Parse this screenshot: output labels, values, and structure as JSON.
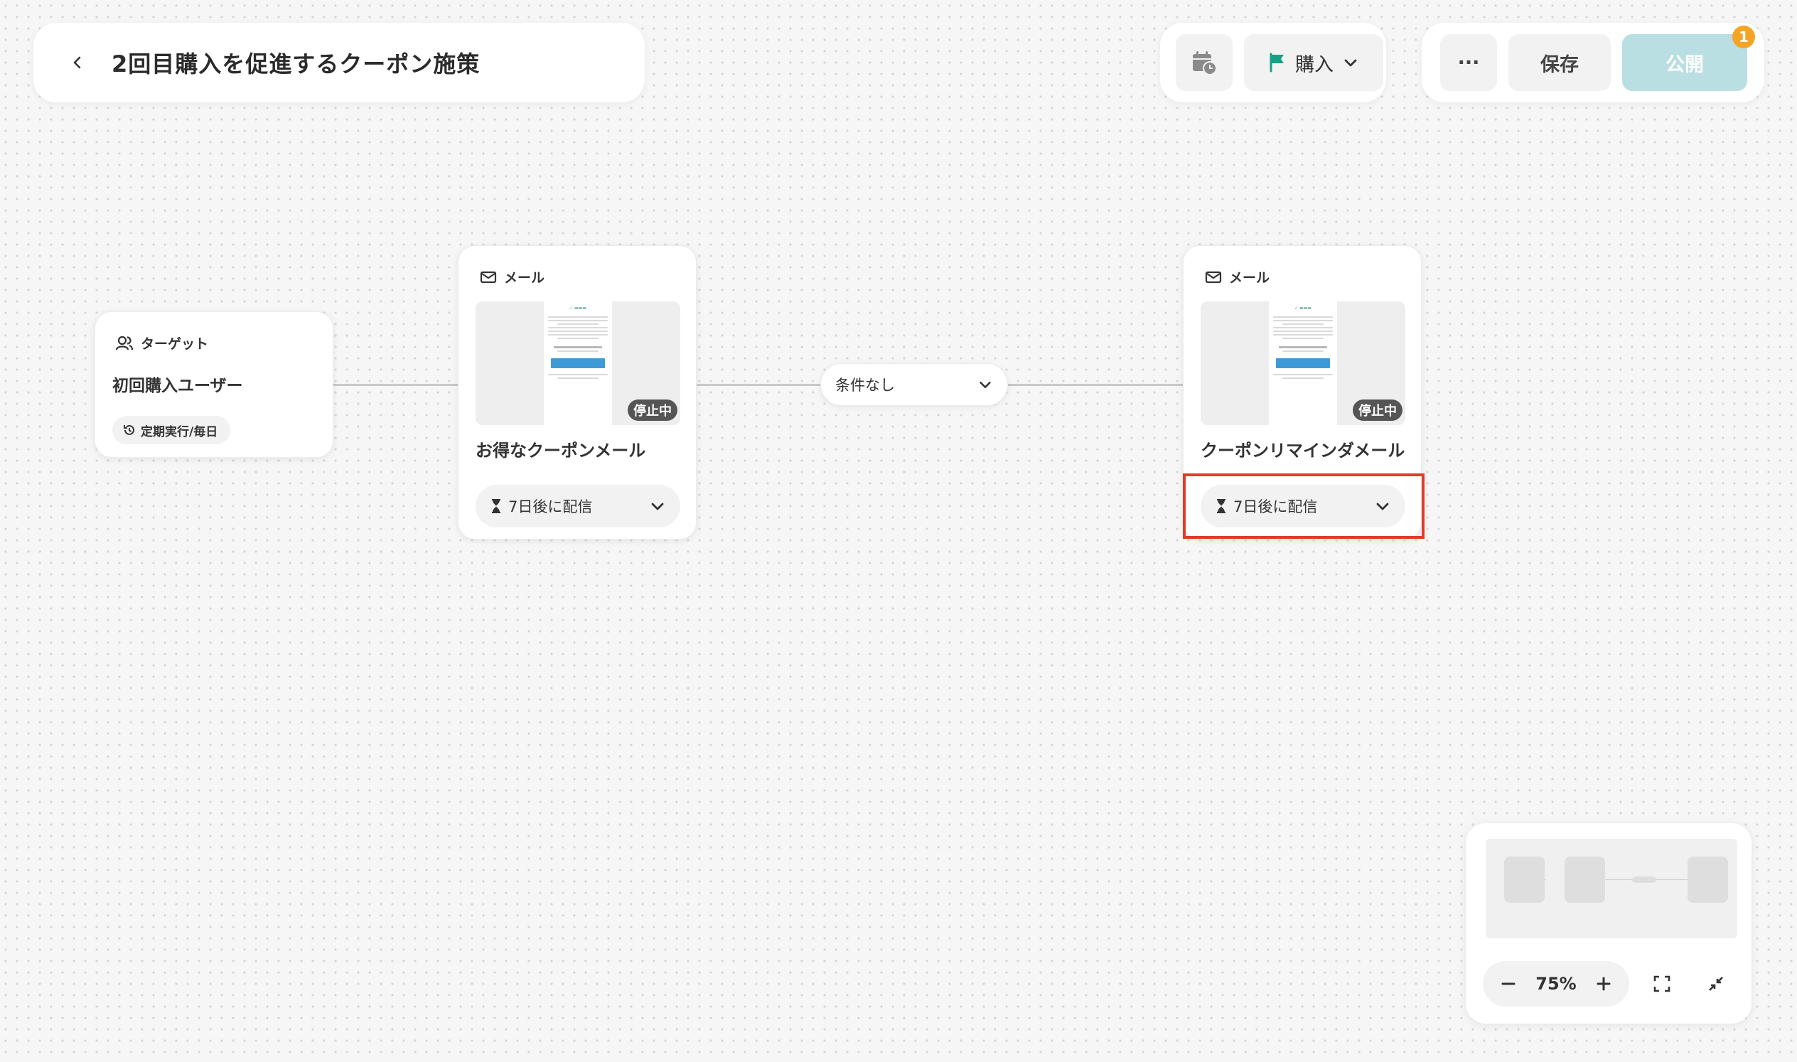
{
  "header": {
    "title": "2回目購入を促進するクーポン施策",
    "back_icon": "chevron-left-icon"
  },
  "toolbar": {
    "schedule_icon": "calendar-clock-icon",
    "goal_label": "購入",
    "more_label": "···",
    "save_label": "保存",
    "publish_label": "公開",
    "notification_count": "1",
    "colors": {
      "goal_flag": "#16a085",
      "publish_bg": "#b9dfe2",
      "badge": "#f5a524"
    }
  },
  "flow": {
    "target": {
      "type_label": "ターゲット",
      "name": "初回購入ユーザー",
      "schedule": "定期実行/毎日"
    },
    "mail1": {
      "type_label": "メール",
      "status": "停止中",
      "name": "お得なクーポンメール",
      "delay": "7日後に配信"
    },
    "condition": {
      "label": "条件なし"
    },
    "mail2": {
      "type_label": "メール",
      "status": "停止中",
      "name": "クーポンリマインダメール",
      "delay": "7日後に配信"
    },
    "highlight_color": "#e53a27"
  },
  "minimap": {
    "zoom": "75%"
  }
}
